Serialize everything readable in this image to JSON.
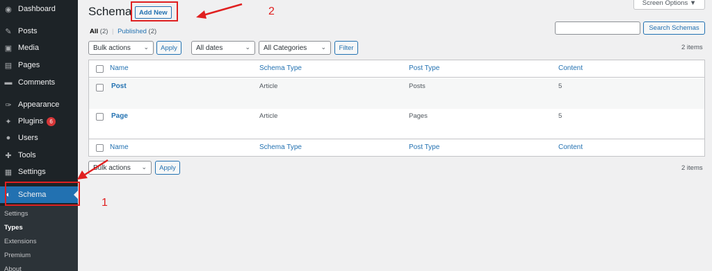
{
  "sidebar": {
    "items": [
      {
        "label": "Dashboard",
        "icon": "dashboard-icon",
        "glyph": "◉"
      },
      {
        "label": "Posts",
        "icon": "pin-icon",
        "glyph": "✎"
      },
      {
        "label": "Media",
        "icon": "media-icon",
        "glyph": "▣"
      },
      {
        "label": "Pages",
        "icon": "pages-icon",
        "glyph": "▤"
      },
      {
        "label": "Comments",
        "icon": "comments-icon",
        "glyph": "▬"
      },
      {
        "label": "Appearance",
        "icon": "brush-icon",
        "glyph": "✑"
      },
      {
        "label": "Plugins",
        "icon": "plugin-icon",
        "glyph": "✦",
        "badge": "6"
      },
      {
        "label": "Users",
        "icon": "users-icon",
        "glyph": "●"
      },
      {
        "label": "Tools",
        "icon": "wrench-icon",
        "glyph": "✚"
      },
      {
        "label": "Settings",
        "icon": "settings-icon",
        "glyph": "▦"
      },
      {
        "label": "Schema",
        "icon": "schema-icon",
        "glyph": "◐"
      }
    ],
    "submenu": [
      "Settings",
      "Types",
      "Extensions",
      "Premium",
      "About"
    ]
  },
  "header": {
    "title": "Schema",
    "add_new": "Add New",
    "screen_options": "Screen Options ▼"
  },
  "views": {
    "all": "All",
    "all_count": "(2)",
    "sep": "|",
    "published": "Published",
    "published_count": "(2)"
  },
  "search": {
    "placeholder": "",
    "button": "Search Schemas"
  },
  "top_filters": {
    "bulk_actions": "Bulk actions",
    "apply": "Apply",
    "dates": "All dates",
    "categories": "All Categories",
    "filter": "Filter",
    "items": "2 items"
  },
  "bottom_filters": {
    "bulk_actions": "Bulk actions",
    "apply": "Apply",
    "items": "2 items"
  },
  "table": {
    "columns": [
      "Name",
      "Schema Type",
      "Post Type",
      "Content"
    ],
    "rows": [
      {
        "name": "Post",
        "schema_type": "Article",
        "post_type": "Posts",
        "content": "5"
      },
      {
        "name": "Page",
        "schema_type": "Article",
        "post_type": "Pages",
        "content": "5"
      }
    ]
  },
  "annotations": {
    "label_1": "1",
    "label_2": "2",
    "color": "#e02020"
  }
}
